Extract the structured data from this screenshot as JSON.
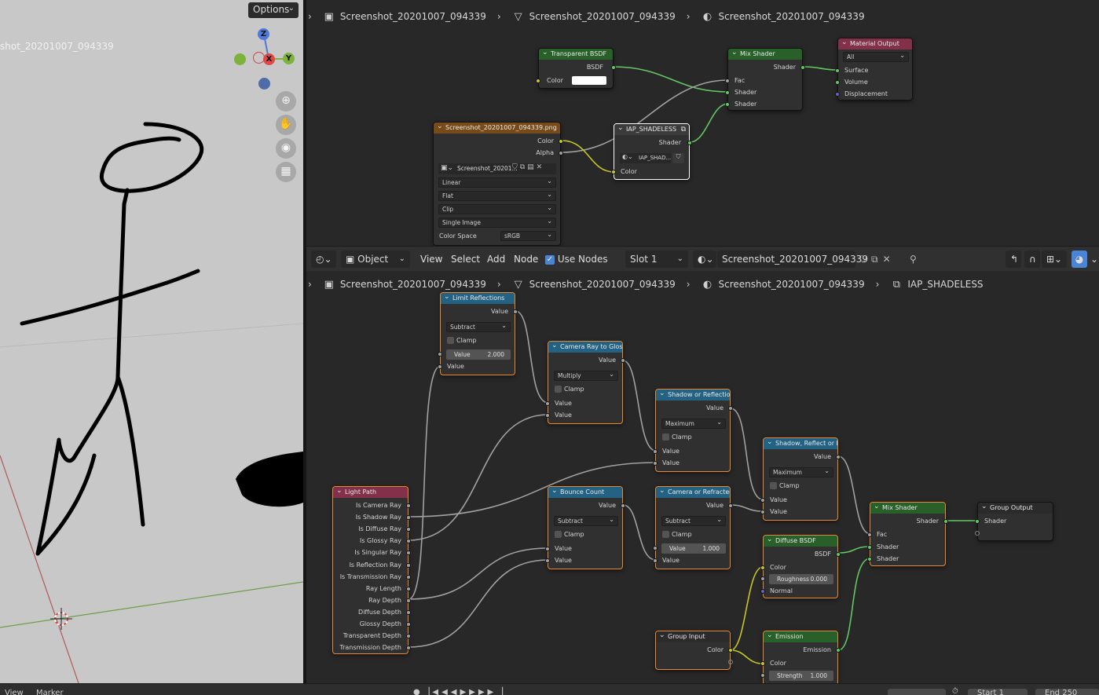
{
  "viewport": {
    "options_label": "Options",
    "object_label": "shot_20201007_094339",
    "axes": {
      "z": "Z",
      "x": "X",
      "y": "Y"
    }
  },
  "top_editor": {
    "breadcrumb": [
      "Screenshot_20201007_094339",
      "Screenshot_20201007_094339",
      "Screenshot_20201007_094339"
    ],
    "nodes": {
      "transparent": {
        "title": "Transparent BSDF",
        "out": "BSDF",
        "in": "Color"
      },
      "mix": {
        "title": "Mix Shader",
        "out": "Shader",
        "in": [
          "Fac",
          "Shader",
          "Shader"
        ]
      },
      "output": {
        "title": "Material Output",
        "target": "All",
        "in": [
          "Surface",
          "Volume",
          "Displacement"
        ]
      },
      "image": {
        "title": "Screenshot_20201007_094339.png",
        "out": [
          "Color",
          "Alpha"
        ],
        "image_name": "Screenshot_20201...",
        "interpolation": "Linear",
        "projection": "Flat",
        "extension": "Clip",
        "source": "Single Image",
        "color_space_label": "Color Space",
        "color_space": "sRGB"
      },
      "group": {
        "title": "IAP_SHADELESS",
        "out": "Shader",
        "tree_name": "IAP_SHAD...",
        "in": "Color"
      }
    }
  },
  "header": {
    "mode": "Object",
    "menus": [
      "View",
      "Select",
      "Add",
      "Node"
    ],
    "use_nodes": "Use Nodes",
    "slot": "Slot 1",
    "material": "Screenshot_20201007_094339"
  },
  "bottom_editor": {
    "breadcrumb": [
      "Screenshot_20201007_094339",
      "Screenshot_20201007_094339",
      "Screenshot_20201007_094339",
      "IAP_SHADELESS"
    ],
    "nodes": {
      "limit": {
        "title": "Limit Reflections",
        "out": "Value",
        "op": "Subtract",
        "clamp": "Clamp",
        "field_label": "Value",
        "field_value": "2.000",
        "in": "Value"
      },
      "cam_glossy": {
        "title": "Camera Ray to Glossy",
        "out": "Value",
        "op": "Multiply",
        "clamp": "Clamp",
        "in": [
          "Value",
          "Value"
        ]
      },
      "shadow_refl": {
        "title": "Shadow or Reflection?",
        "out": "Value",
        "op": "Maximum",
        "clamp": "Clamp",
        "in": [
          "Value",
          "Value"
        ]
      },
      "shadow_refl_r": {
        "title": "Shadow, Reflect or R...",
        "out": "Value",
        "op": "Maximum",
        "clamp": "Clamp",
        "in": [
          "Value",
          "Value"
        ]
      },
      "light_path": {
        "title": "Light Path",
        "outs": [
          "Is Camera Ray",
          "Is Shadow Ray",
          "Is Diffuse Ray",
          "Is Glossy Ray",
          "Is Singular Ray",
          "Is Reflection Ray",
          "Is Transmission Ray",
          "Ray Length",
          "Ray Depth",
          "Diffuse Depth",
          "Glossy Depth",
          "Transparent Depth",
          "Transmission Depth"
        ]
      },
      "bounce": {
        "title": "Bounce Count",
        "out": "Value",
        "op": "Subtract",
        "clamp": "Clamp",
        "in": [
          "Value",
          "Value"
        ]
      },
      "cam_refr": {
        "title": "Camera or Refracted",
        "out": "Value",
        "op": "Subtract",
        "clamp": "Clamp",
        "field_label": "Value",
        "field_value": "1.000",
        "in": "Value"
      },
      "mix": {
        "title": "Mix Shader",
        "out": "Shader",
        "in": [
          "Fac",
          "Shader",
          "Shader"
        ]
      },
      "group_out": {
        "title": "Group Output",
        "in": "Shader"
      },
      "diffuse": {
        "title": "Diffuse BSDF",
        "out": "BSDF",
        "in_color": "Color",
        "rough_label": "Roughness",
        "rough_value": "0.000",
        "normal": "Normal"
      },
      "group_in": {
        "title": "Group Input",
        "out": "Color"
      },
      "emission": {
        "title": "Emission",
        "out": "Emission",
        "in_color": "Color",
        "strength_label": "Strength",
        "strength_value": "1.000"
      }
    }
  },
  "timeline": {
    "view": "View",
    "marker": "Marker",
    "start_label": "Start",
    "start": "1",
    "end_label": "End",
    "end": "250"
  }
}
